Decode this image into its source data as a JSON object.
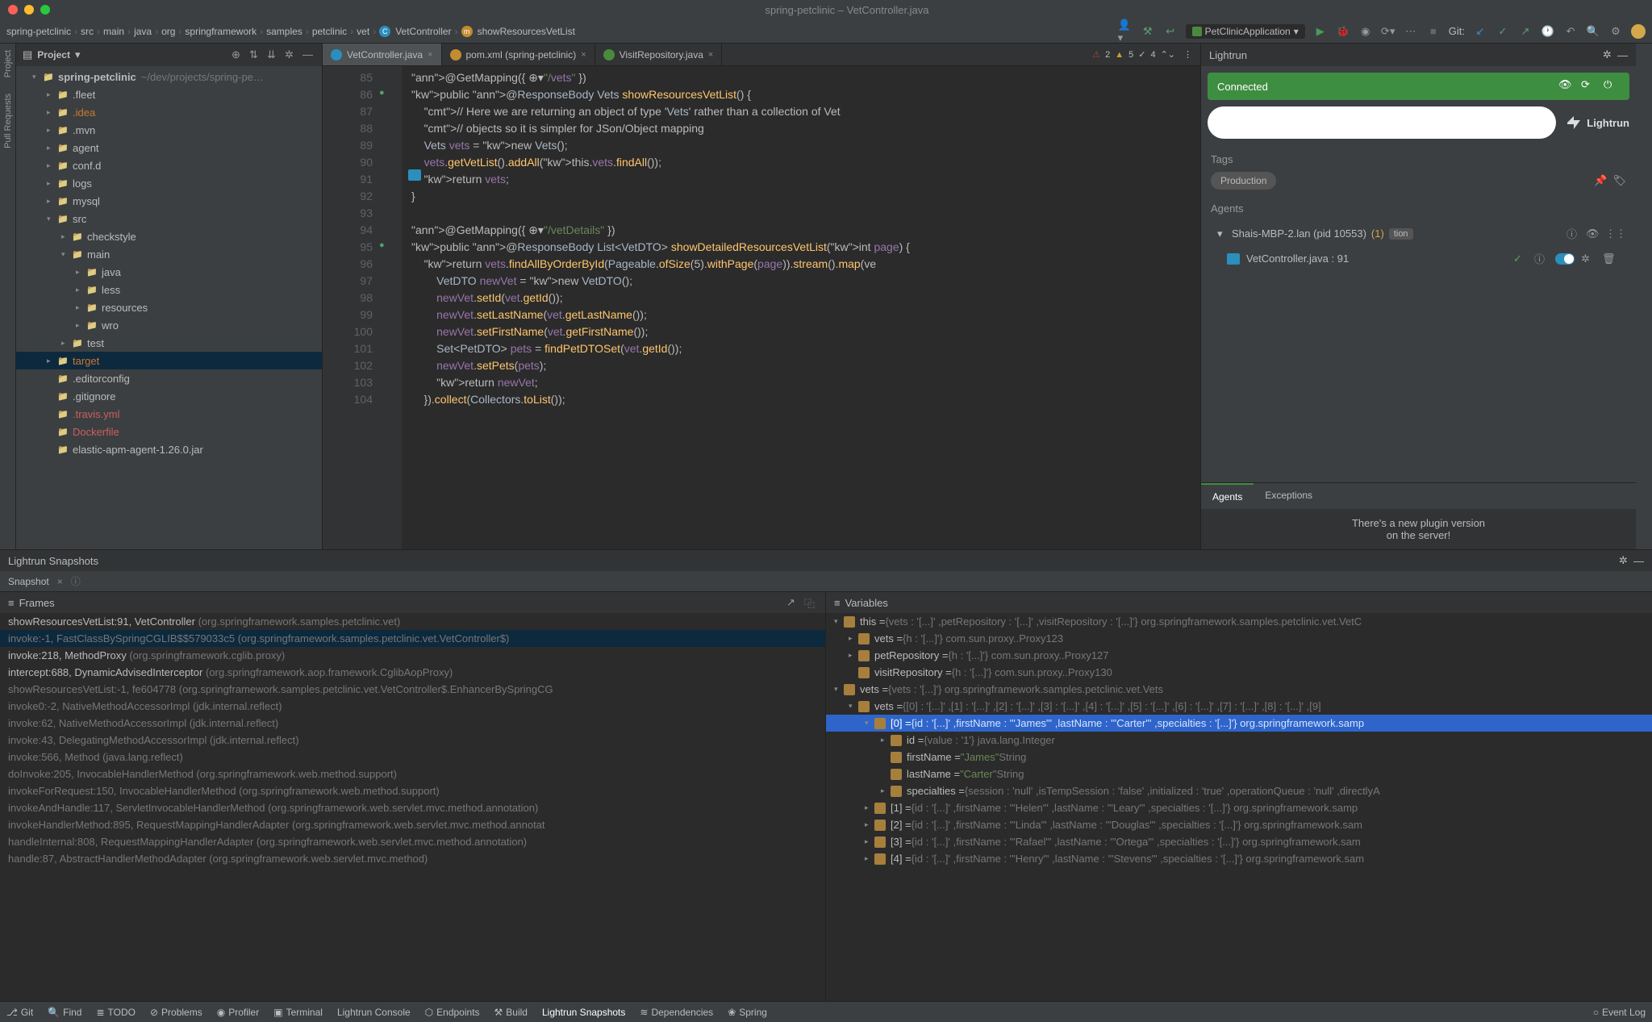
{
  "window": {
    "title": "spring-petclinic – VetController.java"
  },
  "breadcrumbs": [
    "spring-petclinic",
    "src",
    "main",
    "java",
    "org",
    "springframework",
    "samples",
    "petclinic",
    "vet",
    "VetController",
    "showResourcesVetList"
  ],
  "runconfig": "PetClinicApplication",
  "git_label": "Git:",
  "project": {
    "title": "Project",
    "root": "spring-petclinic",
    "root_path": "~/dev/projects/spring-pe…",
    "nodes": [
      {
        "name": ".fleet",
        "ind": 2,
        "arrow": "▸"
      },
      {
        "name": ".idea",
        "ind": 2,
        "arrow": "▸",
        "cls": "orange"
      },
      {
        "name": ".mvn",
        "ind": 2,
        "arrow": "▸"
      },
      {
        "name": "agent",
        "ind": 2,
        "arrow": "▸"
      },
      {
        "name": "conf.d",
        "ind": 2,
        "arrow": "▸"
      },
      {
        "name": "logs",
        "ind": 2,
        "arrow": "▸"
      },
      {
        "name": "mysql",
        "ind": 2,
        "arrow": "▸"
      },
      {
        "name": "src",
        "ind": 2,
        "arrow": "▾"
      },
      {
        "name": "checkstyle",
        "ind": 3,
        "arrow": "▸"
      },
      {
        "name": "main",
        "ind": 3,
        "arrow": "▾"
      },
      {
        "name": "java",
        "ind": 4,
        "arrow": "▸"
      },
      {
        "name": "less",
        "ind": 4,
        "arrow": "▸"
      },
      {
        "name": "resources",
        "ind": 4,
        "arrow": "▸"
      },
      {
        "name": "wro",
        "ind": 4,
        "arrow": "▸"
      },
      {
        "name": "test",
        "ind": 3,
        "arrow": "▸"
      },
      {
        "name": "target",
        "ind": 2,
        "arrow": "▸",
        "cls": "orange",
        "sel": true
      },
      {
        "name": ".editorconfig",
        "ind": 2,
        "arrow": "",
        "icon": "gear"
      },
      {
        "name": ".gitignore",
        "ind": 2,
        "arrow": ""
      },
      {
        "name": ".travis.yml",
        "ind": 2,
        "arrow": "",
        "cls": "red"
      },
      {
        "name": "Dockerfile",
        "ind": 2,
        "arrow": "",
        "cls": "red"
      },
      {
        "name": "elastic-apm-agent-1.26.0.jar",
        "ind": 2,
        "arrow": ""
      }
    ]
  },
  "tabs": [
    {
      "label": "VetController.java",
      "icon": "c",
      "active": true
    },
    {
      "label": "pom.xml (spring-petclinic)",
      "icon": "m"
    },
    {
      "label": "VisitRepository.java",
      "icon": "i"
    }
  ],
  "inspection": {
    "err": "2",
    "warn1": "5",
    "warn2": "4",
    "up": ""
  },
  "gutter_start": 85,
  "code_lines": [
    "@GetMapping({ ⊕▾\"/vets\" })",
    "public @ResponseBody Vets showResourcesVetList() {",
    "    // Here we are returning an object of type 'Vets' rather than a collection of Vet",
    "    // objects so it is simpler for JSon/Object mapping",
    "    Vets vets = new Vets();",
    "    vets.getVetList().addAll(this.vets.findAll());",
    "    return vets;",
    "}",
    "",
    "@GetMapping({ ⊕▾\"/vetDetails\" })",
    "public @ResponseBody List<VetDTO> showDetailedResourcesVetList(int page) {",
    "    return vets.findAllByOrderById(Pageable.ofSize(5).withPage(page)).stream().map(ve",
    "        VetDTO newVet = new VetDTO();",
    "        newVet.setId(vet.getId());",
    "        newVet.setLastName(vet.getLastName());",
    "        newVet.setFirstName(vet.getFirstName());",
    "        Set<PetDTO> pets = findPetDTOSet(vet.getId());",
    "        newVet.setPets(pets);",
    "        return newVet;",
    "    }).collect(Collectors.toList());"
  ],
  "lightrun": {
    "title": "Lightrun",
    "connected": "Connected",
    "logo": "Lightrun",
    "search_placeholder": "",
    "tags_label": "Tags",
    "tag": "Production",
    "agents_label": "Agents",
    "agent": "Shais-MBP-2.lan (pid 10553)",
    "agent_count": "(1)",
    "agent_badge": "tion",
    "snapshot": "VetController.java : 91",
    "btabs": [
      "Agents",
      "Exceptions"
    ],
    "notice": "There's a new plugin version\non the server!"
  },
  "snapshots": {
    "title": "Lightrun Snapshots",
    "tab": "Snapshot",
    "frames_title": "Frames",
    "vars_title": "Variables"
  },
  "frames": [
    {
      "main": "showResourcesVetList:91, VetController",
      "pkg": "(org.springframework.samples.petclinic.vet)",
      "dim": false
    },
    {
      "main": "invoke:-1, FastClassBySpringCGLIB$$579033c5 (org.springframework.samples.petclinic.vet.VetController$)",
      "dim": true,
      "sel": true
    },
    {
      "main": "invoke:218, MethodProxy",
      "pkg": "(org.springframework.cglib.proxy)",
      "dim": false
    },
    {
      "main": "intercept:688, DynamicAdvisedInterceptor",
      "pkg": "(org.springframework.aop.framework.CglibAopProxy)",
      "dim": false
    },
    {
      "main": "showResourcesVetList:-1, fe604778 (org.springframework.samples.petclinic.vet.VetController$.EnhancerBySpringCG",
      "dim": true
    },
    {
      "main": "invoke0:-2, NativeMethodAccessorImpl (jdk.internal.reflect)",
      "dim": true
    },
    {
      "main": "invoke:62, NativeMethodAccessorImpl (jdk.internal.reflect)",
      "dim": true
    },
    {
      "main": "invoke:43, DelegatingMethodAccessorImpl (jdk.internal.reflect)",
      "dim": true
    },
    {
      "main": "invoke:566, Method (java.lang.reflect)",
      "dim": true
    },
    {
      "main": "doInvoke:205, InvocableHandlerMethod (org.springframework.web.method.support)",
      "dim": true
    },
    {
      "main": "invokeForRequest:150, InvocableHandlerMethod (org.springframework.web.method.support)",
      "dim": true
    },
    {
      "main": "invokeAndHandle:117, ServletInvocableHandlerMethod (org.springframework.web.servlet.mvc.method.annotation)",
      "dim": true
    },
    {
      "main": "invokeHandlerMethod:895, RequestMappingHandlerAdapter (org.springframework.web.servlet.mvc.method.annotat",
      "dim": true
    },
    {
      "main": "handleInternal:808, RequestMappingHandlerAdapter (org.springframework.web.servlet.mvc.method.annotation)",
      "dim": true
    },
    {
      "main": "handle:87, AbstractHandlerMethodAdapter (org.springframework.web.servlet.mvc.method)",
      "dim": true
    }
  ],
  "vars": [
    {
      "ind": 0,
      "arrow": "▾",
      "name": "this = ",
      "val": "{vets : '[...]' ,petRepository : '[...]' ,visitRepository : '[...]'} org.springframework.samples.petclinic.vet.VetC"
    },
    {
      "ind": 1,
      "arrow": "▸",
      "name": "vets = ",
      "val": "{h : '[...]'} com.sun.proxy..Proxy123"
    },
    {
      "ind": 1,
      "arrow": "▸",
      "name": "petRepository = ",
      "val": "{h : '[...]'} com.sun.proxy..Proxy127"
    },
    {
      "ind": 1,
      "arrow": "",
      "name": "visitRepository = ",
      "val": "{h : '[...]'} com.sun.proxy..Proxy130"
    },
    {
      "ind": 0,
      "arrow": "▾",
      "name": "vets = ",
      "val": "{vets : '[...]'} org.springframework.samples.petclinic.vet.Vets"
    },
    {
      "ind": 1,
      "arrow": "▾",
      "name": "vets = ",
      "val": "{[0] : '[...]' ,[1] : '[...]' ,[2] : '[...]' ,[3] : '[...]' ,[4] : '[...]' ,[5] : '[...]' ,[6] : '[...]' ,[7] : '[...]' ,[8] : '[...]' ,[9]"
    },
    {
      "ind": 2,
      "arrow": "▾",
      "name": "[0] = ",
      "val": "{id : '[...]' ,firstName : '\"James\"' ,lastName : '\"Carter\"' ,specialties : '[...]'} org.springframework.samp",
      "sel": true
    },
    {
      "ind": 3,
      "arrow": "▸",
      "name": "id = ",
      "val": "{value : '1'} java.lang.Integer"
    },
    {
      "ind": 3,
      "arrow": "",
      "name": "firstName = ",
      "str": "\"James\"",
      "val": " String"
    },
    {
      "ind": 3,
      "arrow": "",
      "name": "lastName = ",
      "str": "\"Carter\"",
      "val": " String"
    },
    {
      "ind": 3,
      "arrow": "▸",
      "name": "specialties = ",
      "val": "{session : 'null' ,isTempSession : 'false' ,initialized : 'true' ,operationQueue : 'null' ,directlyA"
    },
    {
      "ind": 2,
      "arrow": "▸",
      "name": "[1] = ",
      "val": "{id : '[...]' ,firstName : '\"Helen\"' ,lastName : '\"Leary\"' ,specialties : '[...]'} org.springframework.samp"
    },
    {
      "ind": 2,
      "arrow": "▸",
      "name": "[2] = ",
      "val": "{id : '[...]' ,firstName : '\"Linda\"' ,lastName : '\"Douglas\"' ,specialties : '[...]'} org.springframework.sam"
    },
    {
      "ind": 2,
      "arrow": "▸",
      "name": "[3] = ",
      "val": "{id : '[...]' ,firstName : '\"Rafael\"' ,lastName : '\"Ortega\"' ,specialties : '[...]'} org.springframework.sam"
    },
    {
      "ind": 2,
      "arrow": "▸",
      "name": "[4] = ",
      "val": "{id : '[...]' ,firstName : '\"Henry\"' ,lastName : '\"Stevens\"' ,specialties : '[...]'} org.springframework.sam"
    }
  ],
  "status": [
    {
      "icon": "branch",
      "label": "Git"
    },
    {
      "icon": "search",
      "label": "Find"
    },
    {
      "icon": "check",
      "label": "TODO"
    },
    {
      "icon": "warn",
      "label": "Problems"
    },
    {
      "icon": "prof",
      "label": "Profiler"
    },
    {
      "icon": "term",
      "label": "Terminal"
    },
    {
      "icon": "",
      "label": "Lightrun Console"
    },
    {
      "icon": "ep",
      "label": "Endpoints"
    },
    {
      "icon": "hammer",
      "label": "Build"
    },
    {
      "icon": "",
      "label": "Lightrun Snapshots",
      "active": true
    },
    {
      "icon": "dep",
      "label": "Dependencies"
    },
    {
      "icon": "leaf",
      "label": "Spring"
    }
  ],
  "status_right": "Event Log"
}
